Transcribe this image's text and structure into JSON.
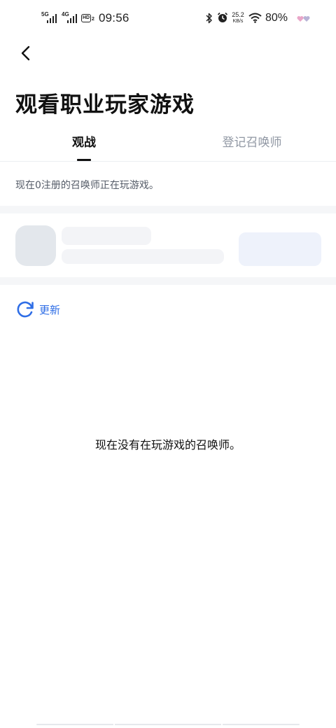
{
  "status_bar": {
    "sim1_network": "5G",
    "sim2_network": "4G",
    "hd_label": "HD",
    "hd_sub": "2",
    "time": "09:56",
    "net_speed_value": "25.2",
    "net_speed_unit": "KB/s",
    "battery": "80%",
    "icons": [
      "signal-icon",
      "hd-voice-icon",
      "bluetooth-icon",
      "alarm-icon",
      "wifi-icon",
      "heart-icon"
    ]
  },
  "header": {
    "back_icon": "chevron-left-icon",
    "title": "观看职业玩家游戏"
  },
  "tabs": [
    {
      "label": "观战",
      "active": true
    },
    {
      "label": "登记召唤师",
      "active": false
    }
  ],
  "online_info": "现在0注册的召唤师正在玩游戏。",
  "refresh": {
    "icon": "refresh-icon",
    "label": "更新",
    "color": "#2f6ee6"
  },
  "empty_state": {
    "message": "现在没有在玩游戏的召唤师。"
  },
  "colors": {
    "accent": "#2f6ee6",
    "text_primary": "#111111",
    "text_secondary": "#9097a3",
    "skeleton": "#f3f4f7",
    "background_band": "#f5f6f8"
  }
}
